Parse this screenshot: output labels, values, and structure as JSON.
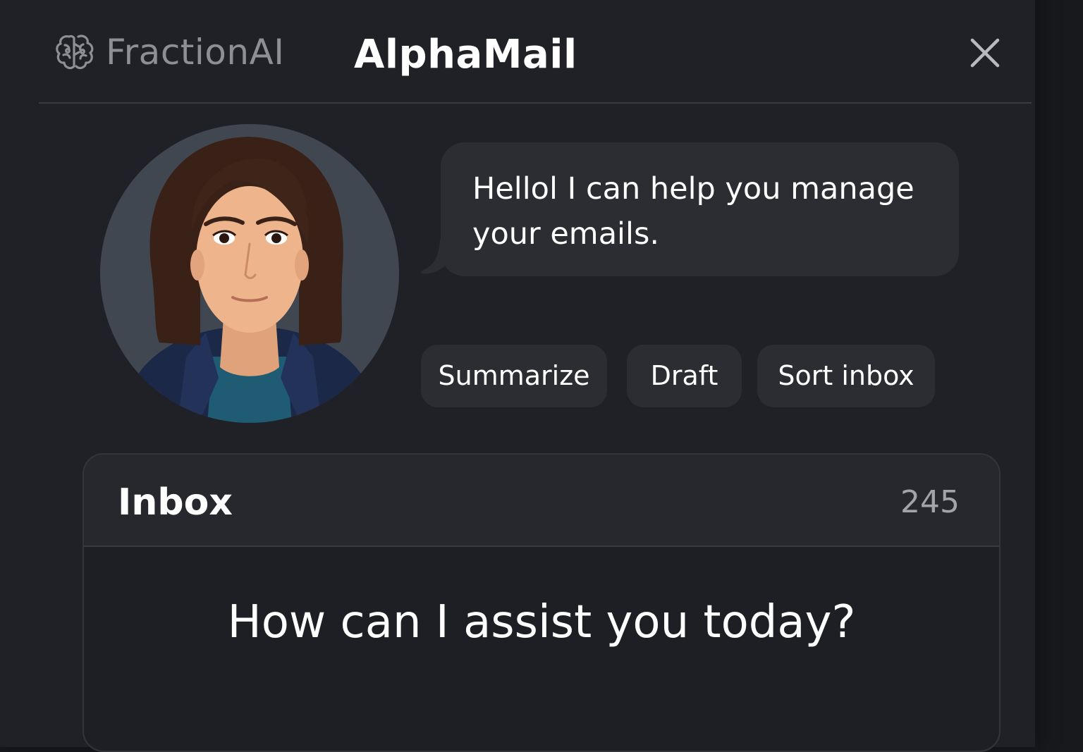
{
  "brand": {
    "name": "FractionAI",
    "logo_icon": "brain-logo-icon"
  },
  "app": {
    "title": "AlphaMail",
    "close_icon": "close-icon"
  },
  "assistant": {
    "avatar": "assistant-avatar",
    "message": "Hellol I can help you manage your emails."
  },
  "actions": [
    {
      "label": "Summarize"
    },
    {
      "label": "Draft"
    },
    {
      "label": "Sort inbox"
    }
  ],
  "inbox": {
    "title": "Inbox",
    "count": "245",
    "prompt": "How can I assist you today?"
  },
  "colors": {
    "background": "#18191d",
    "panel": "#202126",
    "bubble": "#2c2d33",
    "text": "#ffffff",
    "muted": "#8e8f95"
  }
}
